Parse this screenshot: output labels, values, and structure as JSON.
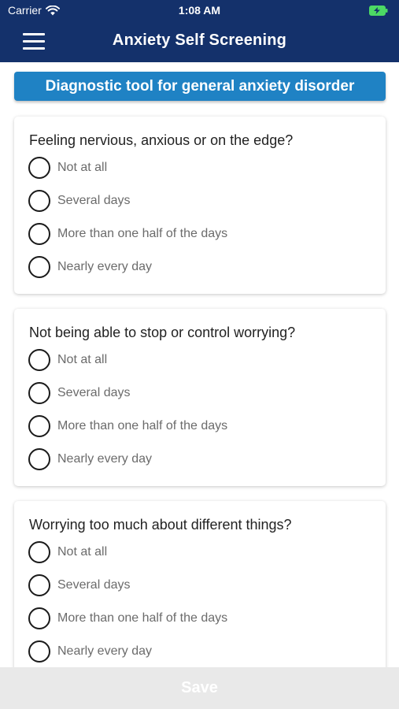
{
  "status_bar": {
    "carrier": "Carrier",
    "time": "1:08 AM",
    "wifi_icon": "wifi-icon",
    "battery_icon": "battery-charging-icon",
    "battery_color": "#4cd964"
  },
  "nav": {
    "title": "Anxiety Self Screening",
    "menu_icon": "hamburger-menu-icon",
    "background": "#14316b"
  },
  "banner": {
    "text": "Diagnostic tool for general anxiety disorder",
    "background": "#1f82c4"
  },
  "questions": [
    {
      "text": "Feeling nervious, anxious or on the edge?",
      "options": [
        "Not at all",
        "Several days",
        "More than one half of the days",
        "Nearly every day"
      ]
    },
    {
      "text": "Not being able to stop or control worrying?",
      "options": [
        "Not at all",
        "Several days",
        "More than one half of the days",
        "Nearly every day"
      ]
    },
    {
      "text": "Worrying too much about different things?",
      "options": [
        "Not at all",
        "Several days",
        "More than one half of the days",
        "Nearly every day"
      ]
    }
  ],
  "footer": {
    "save_label": "Save"
  }
}
